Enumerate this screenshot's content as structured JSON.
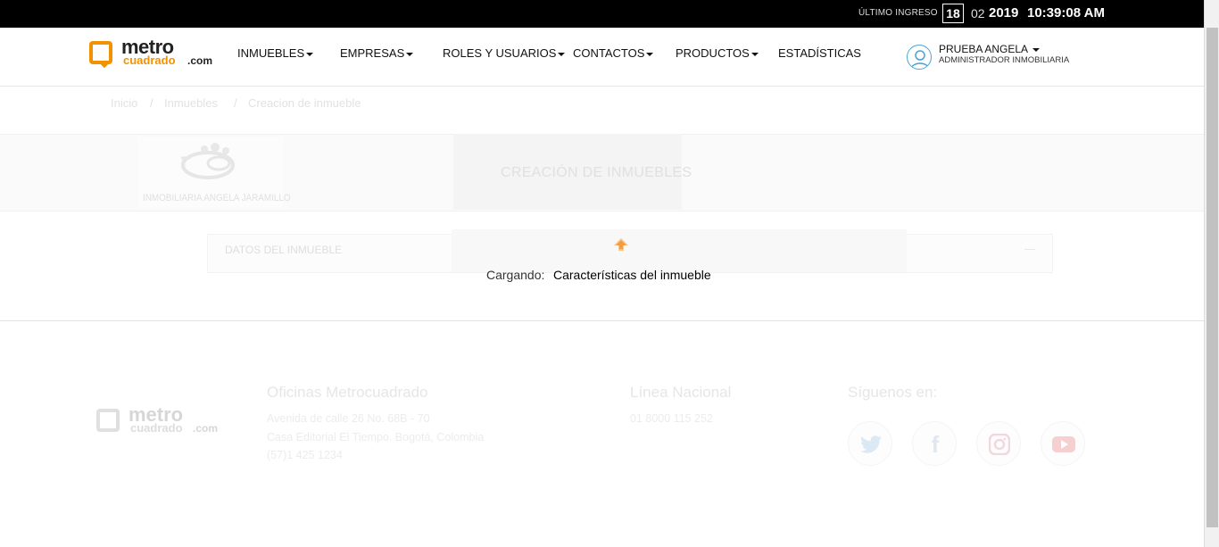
{
  "topbar": {
    "last_login_label": "ÚLTIMO INGRESO",
    "day": "18",
    "month": "02",
    "year": "2019",
    "time": "10:39:08 AM"
  },
  "brand": {
    "logo_word1": "metro",
    "logo_word2": "cuadrado",
    "logo_word3": ".com",
    "accent_color": "#f39200"
  },
  "nav": {
    "items": [
      {
        "label": "INMUEBLES",
        "has_dropdown": true
      },
      {
        "label": "EMPRESAS",
        "has_dropdown": true
      },
      {
        "label": "ROLES Y USUARIOS",
        "has_dropdown": true
      },
      {
        "label": "CONTACTOS",
        "has_dropdown": true
      },
      {
        "label": "PRODUCTOS",
        "has_dropdown": true
      },
      {
        "label": "ESTADÍSTICAS",
        "has_dropdown": false
      }
    ]
  },
  "user": {
    "name": "PRUEBA ANGELA",
    "role": "ADMINISTRADOR INMOBILIARIA"
  },
  "breadcrumb": {
    "items": [
      "Inicio",
      "Inmuebles",
      "Creacion de inmueble"
    ],
    "separator": "/"
  },
  "company": {
    "name": "INMOBILIARIA ANGELA JARAMILLO"
  },
  "page": {
    "heading": "CREACIÓN DE INMUEBLES"
  },
  "section": {
    "title": "DATOS DEL INMUEBLE"
  },
  "loading": {
    "label": "Cargando:",
    "value": "Características del inmueble"
  },
  "footer": {
    "offices_title": "Oficinas Metrocuadrado",
    "offices_lines": [
      "Avenida de calle 26 No. 68B - 70",
      "Casa Editorial El Tiempo. Bogotá, Colombia",
      "(57)1 425 1234"
    ],
    "national_title": "Línea Nacional",
    "national_phone": "01 8000 115 252",
    "social_title": "Síguenos en:",
    "social": [
      "twitter-icon",
      "facebook-icon",
      "instagram-icon",
      "youtube-icon"
    ]
  }
}
